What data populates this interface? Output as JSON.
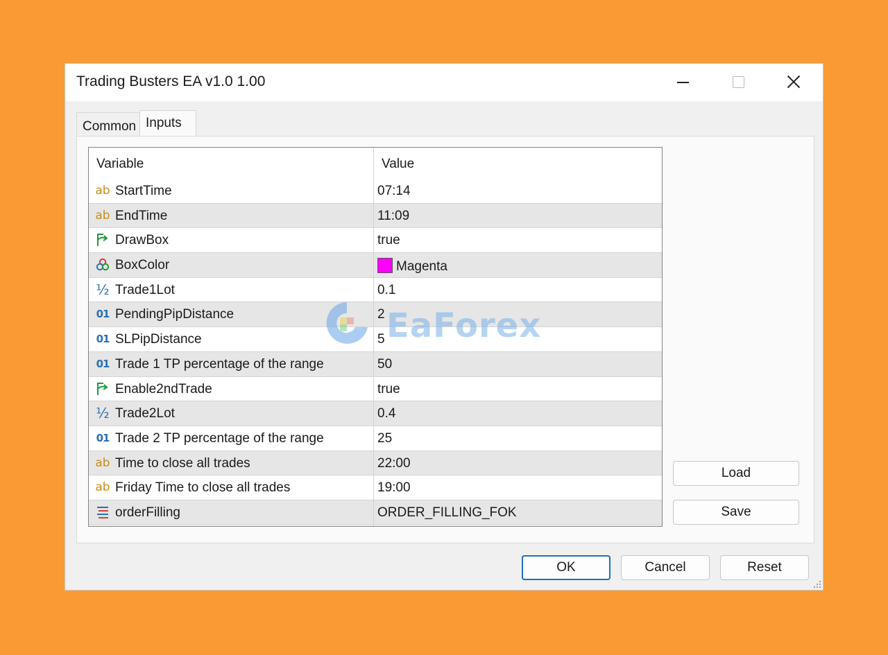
{
  "window": {
    "title": "Trading Busters EA v1.0 1.00"
  },
  "tabs": [
    {
      "label": "Common",
      "active": false
    },
    {
      "label": "Inputs",
      "active": true
    }
  ],
  "grid": {
    "columns": {
      "variable": "Variable",
      "value": "Value"
    },
    "rows": [
      {
        "icon": "string-icon",
        "glyph": "ab",
        "name": "StartTime",
        "value": "07:14"
      },
      {
        "icon": "string-icon",
        "glyph": "ab",
        "name": "EndTime",
        "value": "11:09"
      },
      {
        "icon": "bool-icon",
        "glyph": "",
        "name": "DrawBox",
        "value": "true"
      },
      {
        "icon": "color-icon",
        "glyph": "",
        "name": "BoxColor",
        "value": "Magenta",
        "color": "#ff00ff"
      },
      {
        "icon": "double-icon",
        "glyph": "½",
        "name": "Trade1Lot",
        "value": "0.1"
      },
      {
        "icon": "integer-icon",
        "glyph": "01",
        "name": "PendingPipDistance",
        "value": "2"
      },
      {
        "icon": "integer-icon",
        "glyph": "01",
        "name": "SLPipDistance",
        "value": "5"
      },
      {
        "icon": "integer-icon",
        "glyph": "01",
        "name": "Trade 1 TP percentage of the range",
        "value": "50"
      },
      {
        "icon": "bool-icon",
        "glyph": "",
        "name": "Enable2ndTrade",
        "value": "true"
      },
      {
        "icon": "double-icon",
        "glyph": "½",
        "name": "Trade2Lot",
        "value": "0.4"
      },
      {
        "icon": "integer-icon",
        "glyph": "01",
        "name": "Trade 2 TP percentage of the range",
        "value": "25"
      },
      {
        "icon": "string-icon",
        "glyph": "ab",
        "name": "Time to close all trades",
        "value": "22:00"
      },
      {
        "icon": "string-icon",
        "glyph": "ab",
        "name": "Friday Time to close all trades",
        "value": "19:00"
      },
      {
        "icon": "enum-icon",
        "glyph": "",
        "name": "orderFilling",
        "value": "ORDER_FILLING_FOK"
      }
    ]
  },
  "side_buttons": {
    "load": "Load",
    "save": "Save"
  },
  "buttons": {
    "ok": "OK",
    "cancel": "Cancel",
    "reset": "Reset"
  },
  "watermark": {
    "text": "EaForex"
  },
  "colors": {
    "background": "#f99a32",
    "accent": "#1a6fbf",
    "boxcolor": "#ff00ff"
  }
}
